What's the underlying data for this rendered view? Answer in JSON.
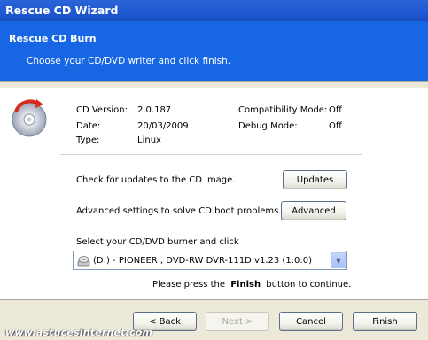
{
  "window": {
    "title": "Rescue CD Wizard"
  },
  "header": {
    "title": "Rescue CD Burn",
    "subtitle": "Choose your CD/DVD writer and click finish."
  },
  "info": {
    "cd_version_label": "CD Version:",
    "cd_version_value": "2.0.187",
    "date_label": "Date:",
    "date_value": "20/03/2009",
    "type_label": "Type:",
    "type_value": "Linux",
    "compat_label": "Compatibility Mode:",
    "compat_value": "Off",
    "debug_label": "Debug Mode:",
    "debug_value": "Off"
  },
  "updates": {
    "text": "Check for updates to the CD image.",
    "button": "Updates"
  },
  "advanced": {
    "text": "Advanced settings to solve CD boot problems.",
    "button": "Advanced"
  },
  "burner": {
    "label": "Select your CD/DVD burner and click",
    "selected": "(D:) - PIONEER , DVD-RW  DVR-111D v1.23 (1:0:0)"
  },
  "hint": {
    "pre": "Please press the",
    "bold": "Finish",
    "post": "button to continue."
  },
  "footer": {
    "back": "< Back",
    "next": "Next >",
    "cancel": "Cancel",
    "finish": "Finish"
  },
  "watermark": "www.astucesinternet.com",
  "colors": {
    "titlebar": "#1e58d0",
    "header": "#1766e4",
    "dialog_face": "#ece9d8"
  }
}
